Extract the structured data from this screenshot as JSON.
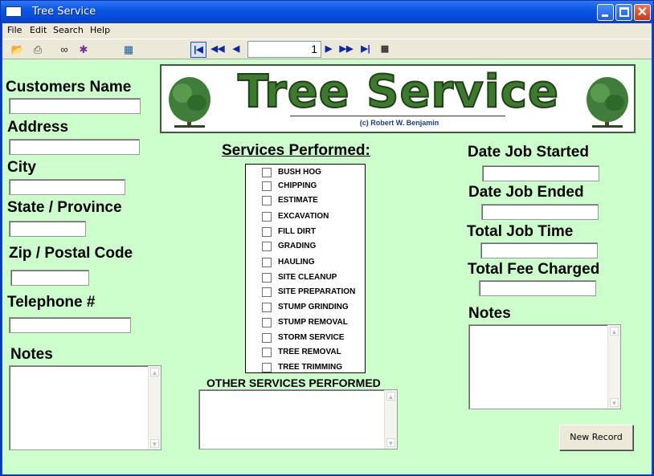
{
  "window": {
    "title": "Tree Service"
  },
  "menu": [
    "File",
    "Edit",
    "Search",
    "Help"
  ],
  "toolbar": {
    "record_number": "1"
  },
  "banner": {
    "title": "Tree Service",
    "credit": "(c) Robert W. Benjamin"
  },
  "left_fields": {
    "customers_name": "Customers Name",
    "address": "Address",
    "city": "City",
    "state": "State / Province",
    "zip": "Zip / Postal Code",
    "telephone": "Telephone #",
    "notes": "Notes"
  },
  "services": {
    "title": "Services Performed:",
    "items": [
      "BUSH HOG",
      "CHIPPING",
      "ESTIMATE",
      "EXCAVATION",
      "FILL DIRT",
      "GRADING",
      "HAULING",
      "SITE CLEANUP",
      "SITE PREPARATION",
      "STUMP GRINDING",
      "STUMP REMOVAL",
      "STORM SERVICE",
      "TREE REMOVAL",
      "TREE TRIMMING"
    ],
    "other_title": "OTHER SERVICES PERFORMED"
  },
  "right_fields": {
    "date_started": "Date Job Started",
    "date_ended": "Date Job Ended",
    "total_time": "Total Job Time",
    "total_fee": "Total Fee Charged",
    "notes": "Notes"
  },
  "buttons": {
    "new_record": "New Record"
  },
  "colors": {
    "form_background": "#ccffcc",
    "title_bar": "#0a56e4",
    "banner_green": "#3e7a2e"
  }
}
